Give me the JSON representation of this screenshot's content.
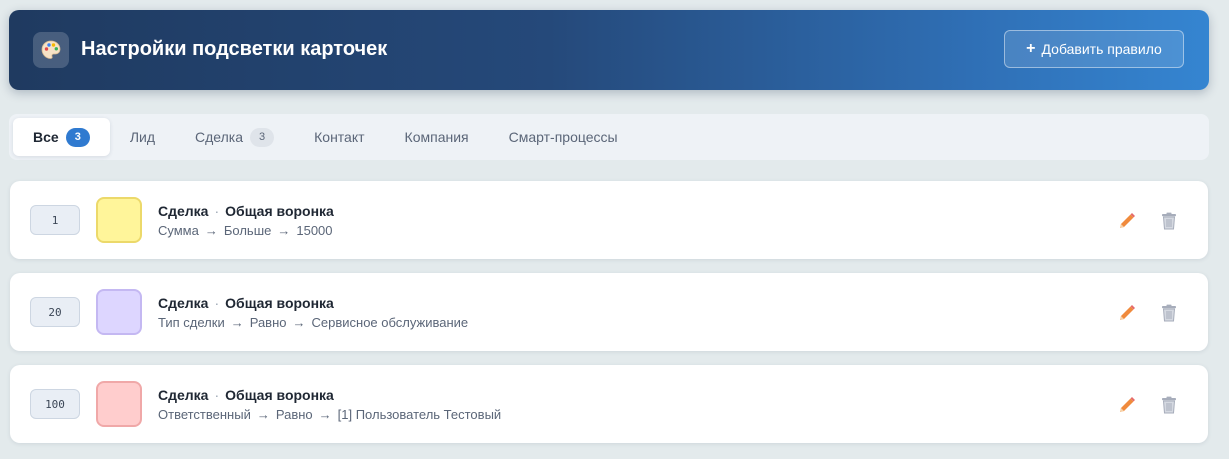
{
  "header": {
    "title": "Настройки подсветки карточек",
    "logo_icon": "palette-icon",
    "add_button_label": "Добавить правило",
    "add_button_icon": "plus-icon"
  },
  "tabs": [
    {
      "label": "Все",
      "count": "3",
      "active": true
    },
    {
      "label": "Лид"
    },
    {
      "label": "Сделка",
      "count": "3"
    },
    {
      "label": "Контакт"
    },
    {
      "label": "Компания"
    },
    {
      "label": "Смарт-процессы"
    }
  ],
  "rules": [
    {
      "priority": "1",
      "color": "#fff59a",
      "border_color": "#ecd96a",
      "entity": "Сделка",
      "pipeline": "Общая воронка",
      "field": "Сумма",
      "operator": "Больше",
      "value": "15000"
    },
    {
      "priority": "20",
      "color": "#ddd6ff",
      "border_color": "#c4b8f2",
      "entity": "Сделка",
      "pipeline": "Общая воронка",
      "field": "Тип сделки",
      "operator": "Равно",
      "value": "Сервисное обслуживание"
    },
    {
      "priority": "100",
      "color": "#ffcdcd",
      "border_color": "#f0a8a8",
      "entity": "Сделка",
      "pipeline": "Общая воронка",
      "field": "Ответственный",
      "operator": "Равно",
      "value": "[1] Пользователь Тестовый"
    }
  ],
  "separator": "·",
  "arrow": "→",
  "icons": {
    "edit": "pencil-icon",
    "delete": "trash-icon"
  },
  "colors": {
    "accent": "#2f7ad0",
    "edit": "#f08a3c",
    "delete": "#a7adbb"
  }
}
